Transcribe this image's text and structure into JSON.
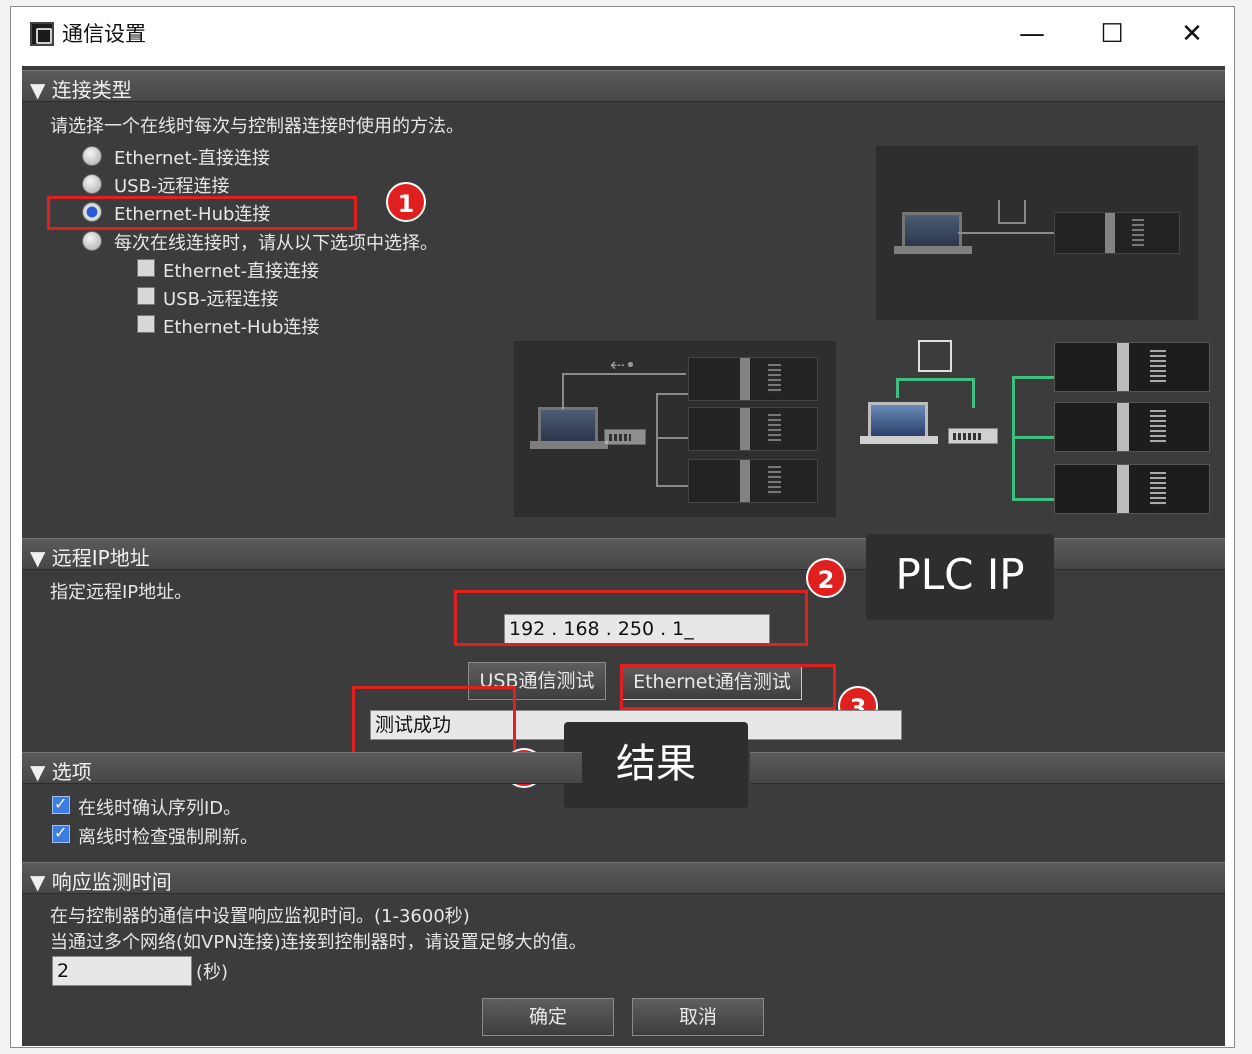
{
  "window": {
    "title": "通信设置",
    "minimize_icon": "—",
    "maximize_icon": "☐",
    "close_icon": "✕"
  },
  "sections": {
    "connection_type": {
      "header": "▼ 连接类型",
      "instruction": "请选择一个在线时每次与控制器连接时使用的方法。",
      "radios": [
        {
          "label": "Ethernet-直接连接",
          "selected": false
        },
        {
          "label": "USB-远程连接",
          "selected": false
        },
        {
          "label": "Ethernet-Hub连接",
          "selected": true
        },
        {
          "label": "每次在线连接时，请从以下选项中选择。",
          "selected": false
        }
      ],
      "sub_options": [
        "Ethernet-直接连接",
        "USB-远程连接",
        "Ethernet-Hub连接"
      ]
    },
    "remote_ip": {
      "header": "▼ 远程IP地址",
      "instruction": "指定远程IP地址。",
      "ip_value": "192 . 168 . 250 . 1_",
      "usb_test_button": "USB通信测试",
      "ethernet_test_button": "Ethernet通信测试",
      "result_value": "测试成功"
    },
    "options": {
      "header": "▼ 选项",
      "checkboxes": [
        {
          "label": "在线时确认序列ID。",
          "checked": true
        },
        {
          "label": "离线时检查强制刷新。",
          "checked": true
        }
      ]
    },
    "response": {
      "header": "▼ 响应监测时间",
      "line1": "在与控制器的通信中设置响应监视时间。(1-3600秒)",
      "line2": "当通过多个网络(如VPN连接)连接到控制器时，请设置足够大的值。",
      "value": "2",
      "unit": "(秒)"
    }
  },
  "footer": {
    "ok_button": "确定",
    "cancel_button": "取消"
  },
  "annotations": {
    "badge1": "1",
    "badge2": "2",
    "badge3": "3",
    "badge4": "4",
    "callout_plc_ip": "PLC IP",
    "callout_result": "结果"
  },
  "colors": {
    "dialog_bg": "#3c3c3c",
    "annotation_red": "#e0201e",
    "hub_green": "#3fbf7f",
    "radio_selected": "#2a5bd6"
  }
}
